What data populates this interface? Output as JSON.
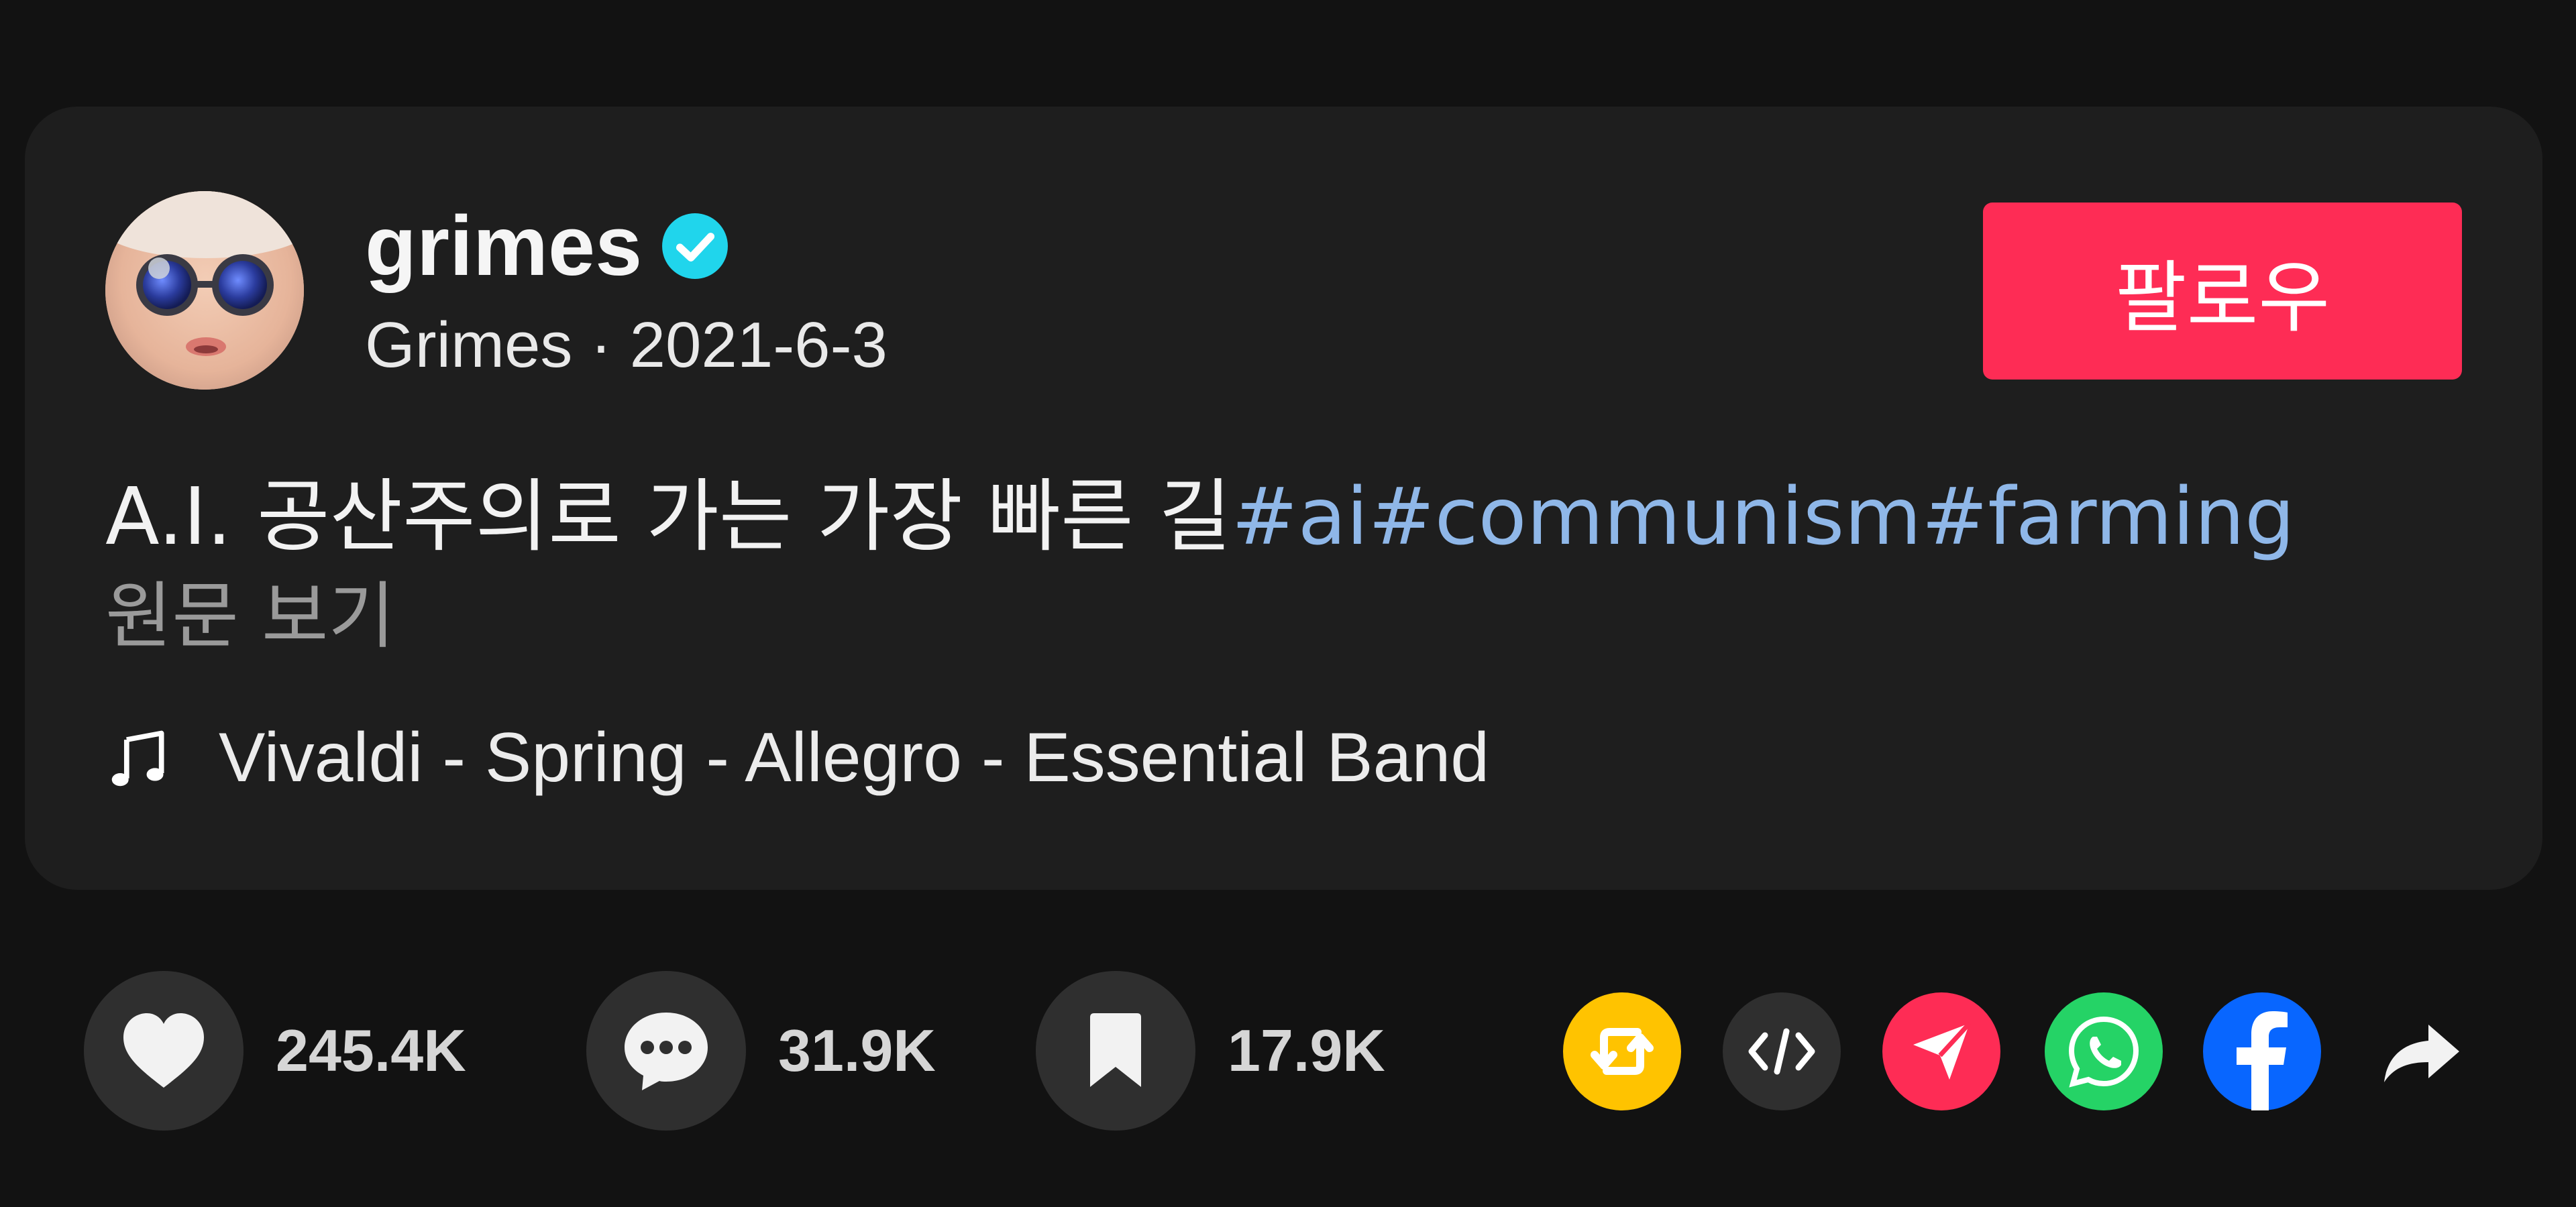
{
  "author": {
    "username": "grimes",
    "display_name": "Grimes",
    "separator": "·",
    "date": "2021-6-3",
    "verified": true
  },
  "follow_label": "팔로우",
  "description": {
    "text": "A.I. 공산주의로 가는 가장 빠른 길",
    "hashtags": [
      "#ai",
      "#communism",
      "#farming"
    ]
  },
  "see_original": "원문 보기",
  "music": {
    "icon": "music-note-icon",
    "title": "Vivaldi - Spring - Allegro - Essential Band"
  },
  "actions": {
    "likes": "245.4K",
    "comments": "31.9K",
    "saves": "17.9K"
  },
  "share_targets": [
    "repost-icon",
    "embed-icon",
    "send-icon",
    "whatsapp-icon",
    "facebook-icon",
    "share-arrow-icon"
  ],
  "colors": {
    "background": "#121212",
    "card": "#1e1e1e",
    "follow": "#fe2c55",
    "hashtag": "#8fb7e8",
    "verified": "#20d5ec",
    "repost": "#ffc300",
    "embed": "#2f2f2f",
    "send": "#fe2c55",
    "whatsapp": "#25d366",
    "facebook": "#0866ff"
  }
}
